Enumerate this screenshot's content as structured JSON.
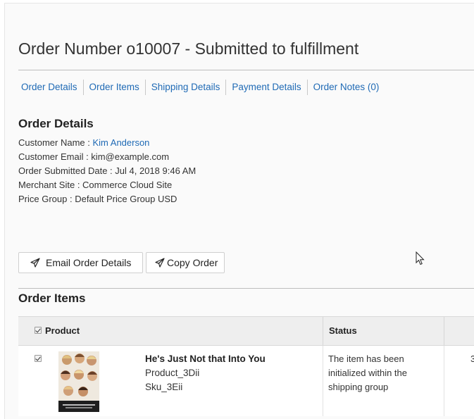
{
  "page": {
    "title": "Order Number o10007 - Submitted to fulfillment"
  },
  "tabs": [
    {
      "label": "Order Details"
    },
    {
      "label": "Order Items"
    },
    {
      "label": "Shipping Details"
    },
    {
      "label": "Payment Details"
    },
    {
      "label": "Order Notes (0)"
    }
  ],
  "order_details": {
    "heading": "Order Details",
    "customer_name_label": "Customer Name : ",
    "customer_name": "Kim Anderson",
    "customer_email": "Customer Email : kim@example.com",
    "submitted_date": "Order Submitted Date : Jul 4, 2018 9:46 AM",
    "merchant_site": "Merchant Site : Commerce Cloud Site",
    "price_group": "Price Group : Default Price Group USD"
  },
  "actions": {
    "email_label": "Email Order Details",
    "copy_label": "Copy Order"
  },
  "order_items": {
    "heading": "Order Items",
    "columns": {
      "product": "Product",
      "status": "Status"
    },
    "rows": [
      {
        "name": "He's Just Not that Into You",
        "product_id": "Product_3Dii",
        "sku": "Sku_3Eii",
        "status": "The item has been initialized within the shipping group",
        "qty": "3",
        "checked": true
      }
    ]
  },
  "icons": {
    "send": "paper-plane-icon",
    "pointer": "mouse-pointer-icon"
  },
  "colors": {
    "link": "#1f6ab5",
    "header_bg": "#eeeeee"
  }
}
